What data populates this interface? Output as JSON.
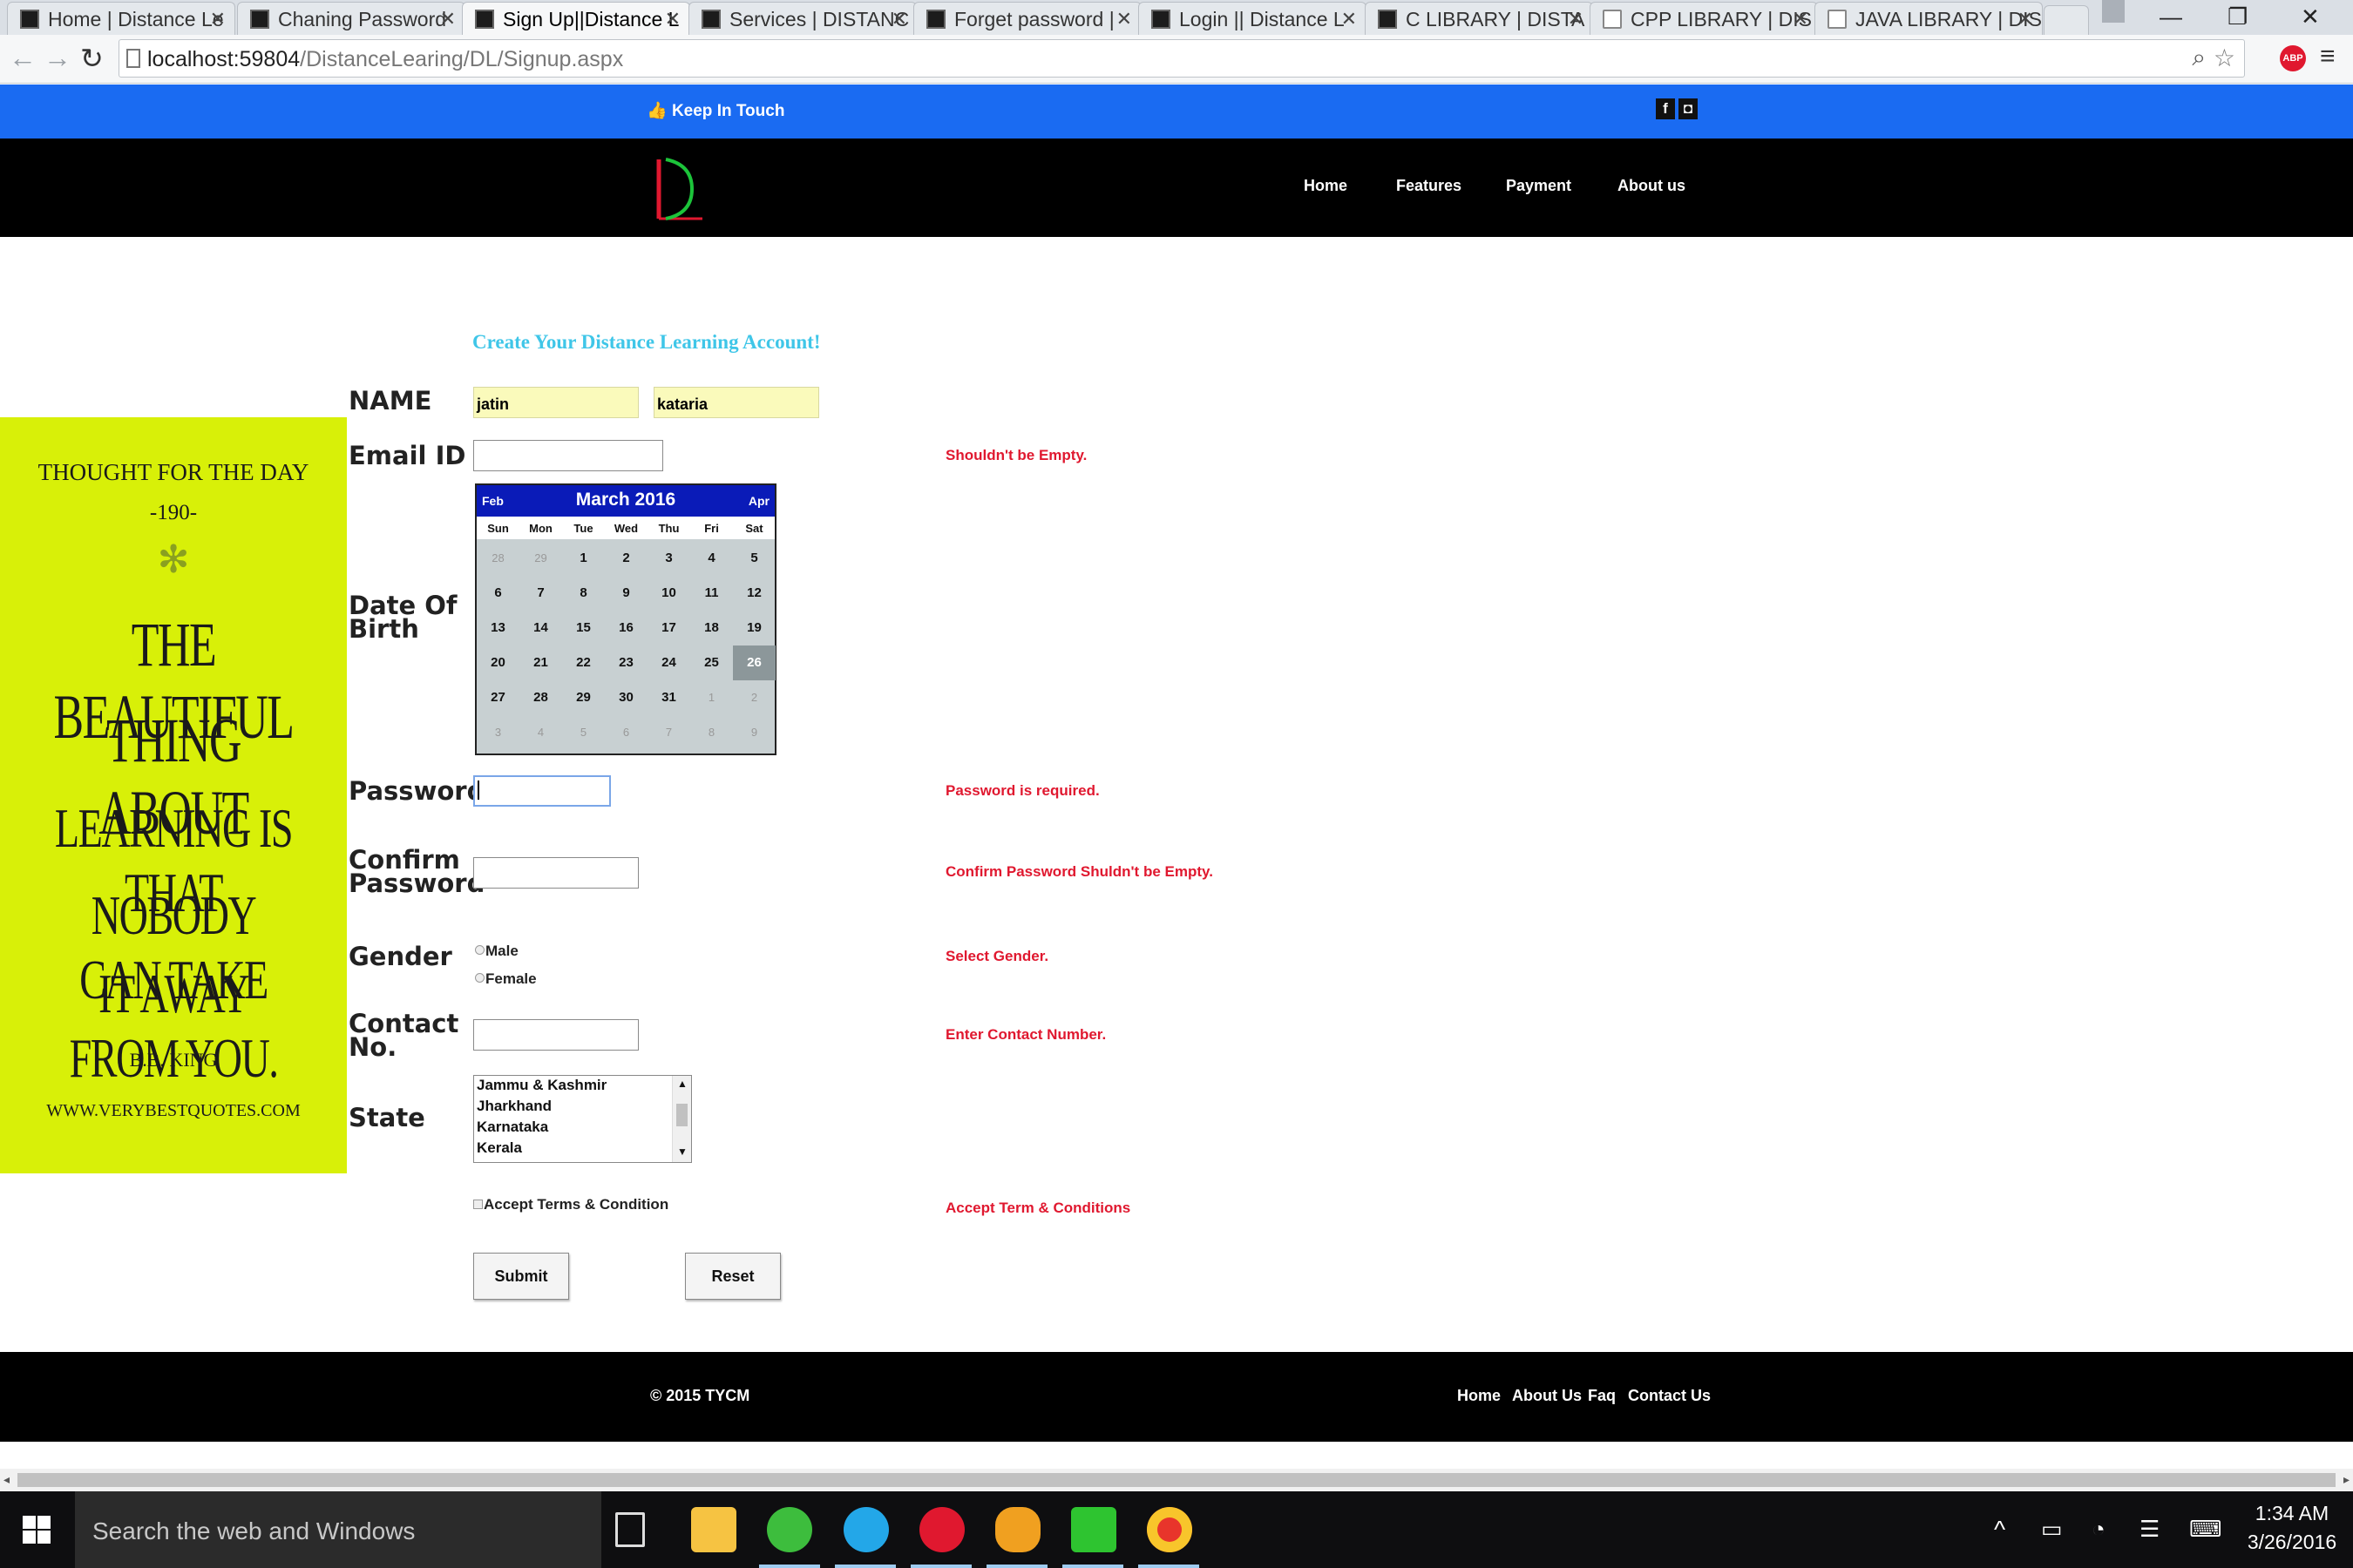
{
  "browser": {
    "tabs": [
      {
        "title": "Home | Distance Le",
        "active": false,
        "icon": "site-icon"
      },
      {
        "title": "Chaning Password",
        "active": false,
        "icon": "site-icon"
      },
      {
        "title": "Sign Up||Distance L",
        "active": true,
        "icon": "site-icon"
      },
      {
        "title": "Services | DISTANC",
        "active": false,
        "icon": "site-icon"
      },
      {
        "title": "Forget password |",
        "active": false,
        "icon": "site-icon"
      },
      {
        "title": "Login || Distance L",
        "active": false,
        "icon": "site-icon"
      },
      {
        "title": "C LIBRARY | DISTA",
        "active": false,
        "icon": "site-icon"
      },
      {
        "title": "CPP LIBRARY | DIS",
        "active": false,
        "icon": "doc-icon"
      },
      {
        "title": "JAVA LIBRARY | DIS",
        "active": false,
        "icon": "doc-icon"
      }
    ],
    "url_host": "localhost:59804",
    "url_path": "/DistanceLearing/DL/Signup.aspx"
  },
  "site": {
    "keep_in_touch": "Keep In Touch",
    "nav": [
      "Home",
      "Features",
      "Payment",
      "About us"
    ],
    "heading": "Create Your Distance Learning Account!"
  },
  "form": {
    "labels": {
      "name": "NAME",
      "email": "Email ID",
      "dob_line1": "Date Of",
      "dob_line2": "Birth",
      "password": "Password",
      "confirm_line1": "Confirm",
      "confirm_line2": "Password",
      "gender": "Gender",
      "contact_line1": "Contact",
      "contact_line2": "No.",
      "state": "State"
    },
    "first_name": "jatin",
    "last_name": "kataria",
    "email": "",
    "password": "",
    "confirm_password": "",
    "contact": "",
    "gender_options": [
      "Male",
      "Female"
    ],
    "state_options": [
      "Jammu & Kashmir",
      "Jharkhand",
      "Karnataka",
      "Kerala"
    ],
    "terms_label": "Accept Terms & Condition",
    "submit": "Submit",
    "reset": "Reset",
    "errors": {
      "email": "Shouldn't be Empty.",
      "password": "Password is required.",
      "confirm": "Confirm Password Shuldn't be Empty.",
      "gender": "Select Gender.",
      "contact": "Enter Contact Number.",
      "terms": "Accept Term & Conditions"
    }
  },
  "calendar": {
    "title": "March 2016",
    "prev": "Feb",
    "next": "Apr",
    "weekdays": [
      "Sun",
      "Mon",
      "Tue",
      "Wed",
      "Thu",
      "Fri",
      "Sat"
    ],
    "weeks": [
      [
        "28",
        "29",
        "1",
        "2",
        "3",
        "4",
        "5"
      ],
      [
        "6",
        "7",
        "8",
        "9",
        "10",
        "11",
        "12"
      ],
      [
        "13",
        "14",
        "15",
        "16",
        "17",
        "18",
        "19"
      ],
      [
        "20",
        "21",
        "22",
        "23",
        "24",
        "25",
        "26"
      ],
      [
        "27",
        "28",
        "29",
        "30",
        "31",
        "1",
        "2"
      ],
      [
        "3",
        "4",
        "5",
        "6",
        "7",
        "8",
        "9"
      ]
    ],
    "selected": "26"
  },
  "quote": {
    "header": "THOUGHT FOR THE DAY",
    "number": "-190-",
    "line1": "THE BEAUTIFUL",
    "line2": "THING ABOUT",
    "line3": "LEARNING IS THAT",
    "line4": "NOBODY CAN TAKE",
    "line5": "IT AWAY FROM YOU.",
    "author": "B.B. KING",
    "site": "WWW.VERYBESTQUOTES.COM"
  },
  "footer": {
    "copyright": "© 2015 TYCM",
    "links": [
      "Home",
      "About Us",
      "Faq",
      "Contact Us"
    ]
  },
  "taskbar": {
    "search_placeholder": "Search the web and Windows",
    "time": "1:34 AM",
    "date": "3/26/2016"
  }
}
